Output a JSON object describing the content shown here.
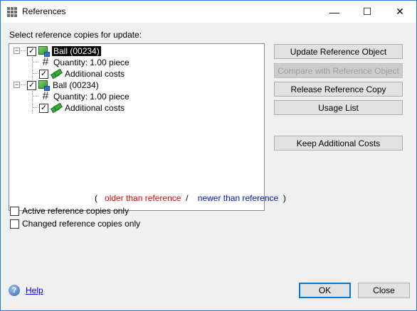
{
  "window": {
    "title": "References"
  },
  "titlebar": {
    "minimize": "—",
    "maximize": "☐",
    "close": "✕"
  },
  "select_label": "Select reference copies for update:",
  "tree": [
    {
      "name": "Ball  (00234)",
      "checked": true,
      "selected": true,
      "children": [
        {
          "text": "Quantity: 1.00 piece",
          "icon": "hash-icon"
        },
        {
          "text": "Additional costs",
          "checked": true,
          "icon": "money-icon"
        }
      ]
    },
    {
      "name": "Ball  (00234)",
      "checked": true,
      "selected": false,
      "children": [
        {
          "text": "Quantity: 1.00 piece",
          "icon": "hash-icon"
        },
        {
          "text": "Additional costs",
          "checked": true,
          "icon": "money-icon"
        }
      ]
    }
  ],
  "buttons": {
    "update_reference": "Update Reference Object",
    "compare_reference": "Compare with Reference Object",
    "release_copy": "Release Reference Copy",
    "usage_list": "Usage List",
    "keep_costs": "Keep Additional Costs"
  },
  "legend": {
    "open": "(",
    "older": "older than reference",
    "sep": "/",
    "newer": "newer than reference",
    "close": ")",
    "older_color": "#e00000",
    "newer_color": "#0010c0"
  },
  "options": {
    "active_only": "Active reference copies only",
    "changed_only": "Changed reference copies only"
  },
  "footer": {
    "help": "Help",
    "ok": "OK",
    "close": "Close"
  },
  "colors": {
    "title_border": "#2b79d6",
    "dialog_bg": "#f0f0f0",
    "default_button_border": "#0078d7"
  }
}
